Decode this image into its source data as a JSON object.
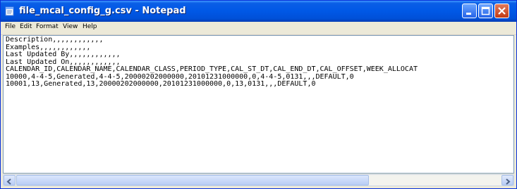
{
  "window": {
    "title": "file_mcal_config_g.csv - Notepad",
    "app_icon": "notepad-icon",
    "controls": {
      "minimize_icon": "minimize-icon",
      "maximize_icon": "maximize-icon",
      "close_icon": "close-icon"
    }
  },
  "menu": {
    "items": [
      {
        "label": "File"
      },
      {
        "label": "Edit"
      },
      {
        "label": "Format"
      },
      {
        "label": "View"
      },
      {
        "label": "Help"
      }
    ]
  },
  "editor": {
    "content": "Description,,,,,,,,,,,,\nExamples,,,,,,,,,,,,\nLast Updated By,,,,,,,,,,,,\nLast Updated On,,,,,,,,,,,,\nCALENDAR_ID,CALENDAR_NAME,CALENDAR_CLASS,PERIOD_TYPE,CAL_ST_DT,CAL_END_DT,CAL_OFFSET,WEEK_ALLOCAT\n10000,4-4-5,Generated,4-4-5,20000202000000,20101231000000,0,4-4-5,0131,,,DEFAULT,0\n10001,13,Generated,13,20000202000000,20101231000000,0,13,0131,,,DEFAULT,0"
  },
  "scrollbar": {
    "left_icon": "arrow-left-icon",
    "right_icon": "arrow-right-icon"
  },
  "colors": {
    "titlebar": "#0058e6",
    "title_text": "#ffffff",
    "chrome": "#ece9d8",
    "editor_bg": "#ffffff"
  }
}
